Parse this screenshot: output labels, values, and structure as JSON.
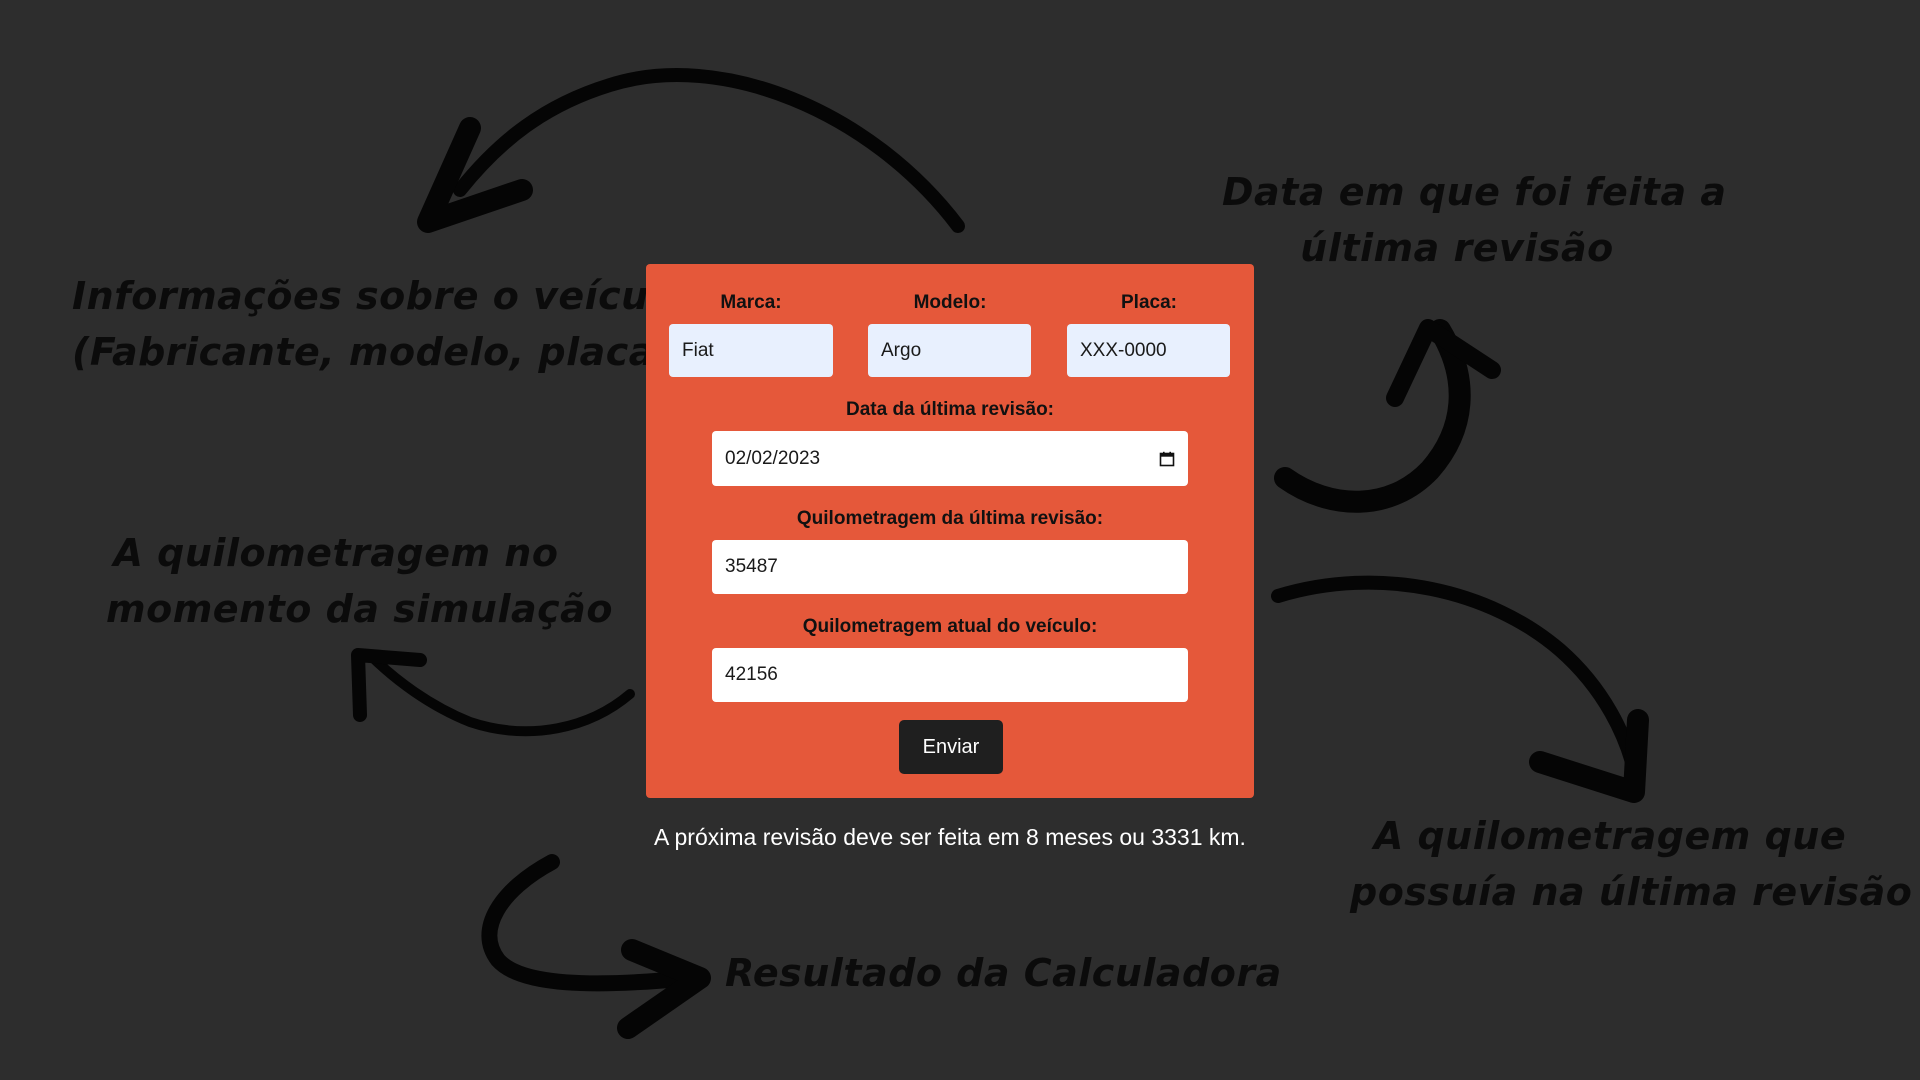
{
  "form": {
    "brand_label": "Marca:",
    "brand_value": "Fiat",
    "model_label": "Modelo:",
    "model_value": "Argo",
    "plate_label": "Placa:",
    "plate_value": "XXX-0000",
    "last_revision_date_label": "Data da última revisão:",
    "last_revision_date_value": "02/02/2023",
    "last_revision_km_label": "Quilometragem da última revisão:",
    "last_revision_km_value": "35487",
    "current_km_label": "Quilometragem atual do veículo:",
    "current_km_value": "42156",
    "submit_label": "Enviar"
  },
  "result": {
    "text": "A próxima revisão deve ser feita em 8 meses ou 3331 km."
  },
  "annotations": {
    "vehicle_info": [
      "Informações sobre o veículo",
      "(Fabricante, modelo, placa)"
    ],
    "revision_date": [
      "Data em que foi feita a",
      "última revisão"
    ],
    "current_km": [
      "A quilometragem no",
      "momento da simulação"
    ],
    "last_km": [
      "A quilometragem que",
      "possuía na última revisão"
    ],
    "result": [
      "Resultado da Calculadora"
    ]
  },
  "colors": {
    "background": "#2d2d2d",
    "card": "#e5583a",
    "button": "#1f1f1f",
    "autofill_input": "#e8f0fe"
  },
  "icons": {
    "date_picker": "calendar-icon",
    "arrows": "hand-drawn-arrow-icon"
  }
}
